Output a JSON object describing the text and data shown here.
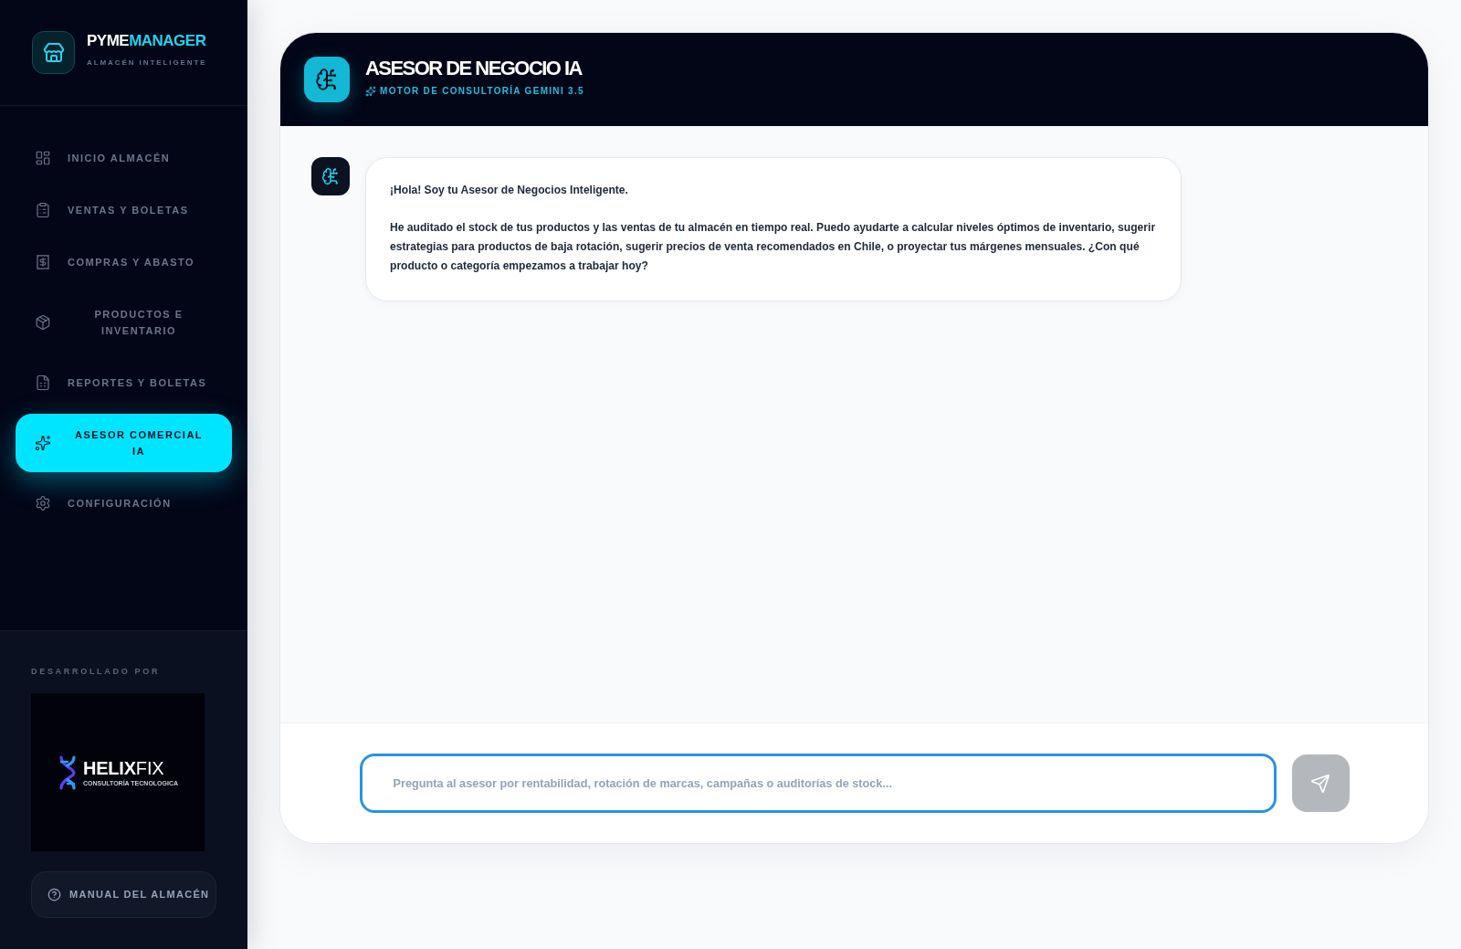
{
  "sidebar": {
    "brand": {
      "name": "PYME",
      "name_accent": "MANAGER",
      "subtitle": "ALMACÉN INTELIGENTE"
    },
    "nav": [
      {
        "label": "INICIO ALMACÉN",
        "selected": false
      },
      {
        "label": "VENTAS Y BOLETAS",
        "selected": false
      },
      {
        "label": "COMPRAS Y ABASTO",
        "selected": false
      },
      {
        "label": "PRODUCTOS E INVENTARIO",
        "selected": false
      },
      {
        "label": "REPORTES Y BOLETAS",
        "selected": false
      },
      {
        "label": "ASESOR COMERCIAL IA",
        "selected": true
      },
      {
        "label": "CONFIGURACIÓN",
        "selected": false
      }
    ],
    "credits": {
      "label": "DESARROLLADO POR",
      "logo_name": "**HELIX**FIX",
      "logo_tagline": "CONSULTORÍA TECNOLOGICA"
    },
    "manual_button": "MANUAL DEL ALMACÉN"
  },
  "chat": {
    "header": {
      "title": "ASESOR DE NEGOCIO IA",
      "subtitle": "MOTOR DE CONSULTORÍA GEMINI 3.5"
    },
    "messages": [
      {
        "kind": "assistant",
        "paragraphs": [
          "¡Hola! Soy tu Asesor de Negocios Inteligente.",
          "He auditado el stock de tus productos y las ventas de tu almacén en tiempo real. Puedo ayudarte a calcular niveles óptimos de inventario, sugerir estrategias para productos de baja rotación, sugerir precios de venta recomendados en Chile, o proyectar tus márgenes mensuales. ¿Con qué producto o categoría empezamos a trabajar hoy?"
        ]
      }
    ],
    "input": {
      "placeholder": "Pregunta al asesor por rentabilidad, rotación de marcas, campañas o auditorías de stock..."
    },
    "send_button": {
      "disabled": true
    }
  }
}
